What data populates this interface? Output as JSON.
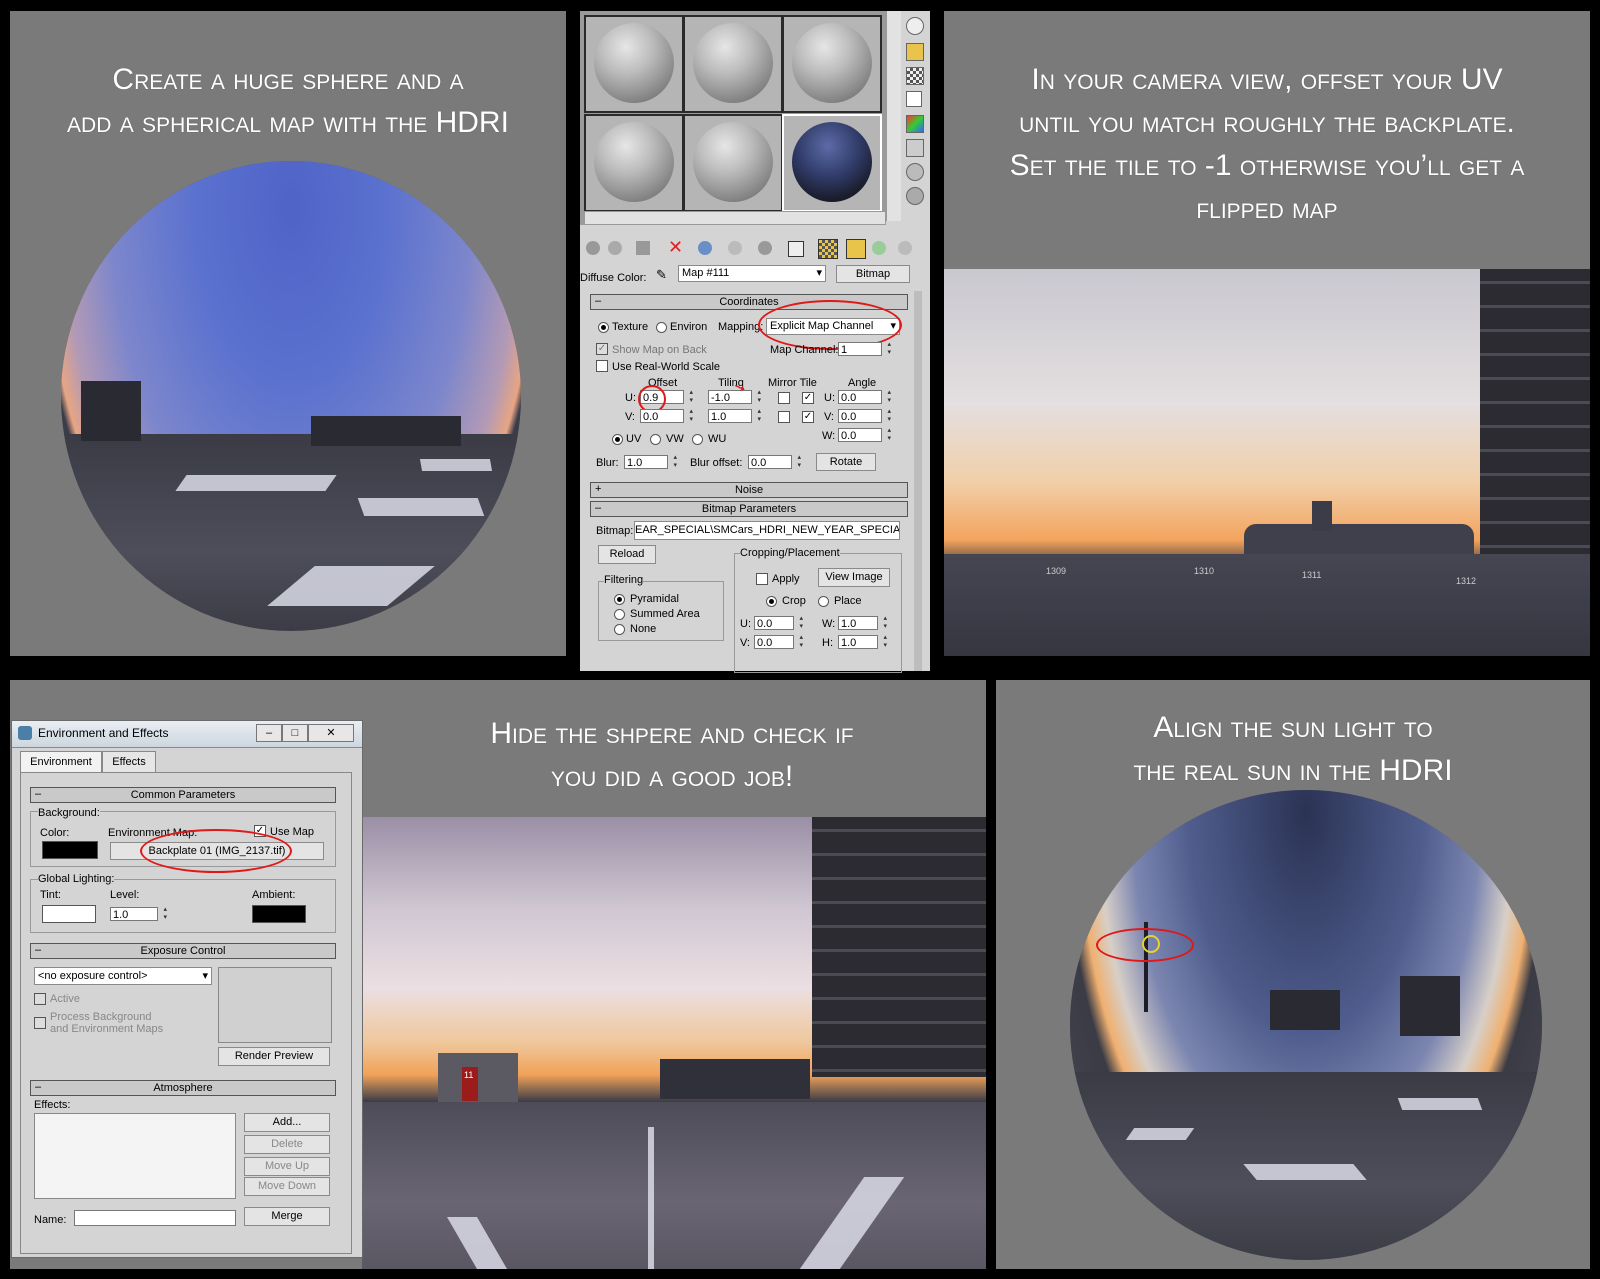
{
  "captions": {
    "top_left": [
      "Create a huge sphere and a",
      "add a spherical map with the HDRI"
    ],
    "top_right": [
      "In your camera view, offset your UV",
      "until you match roughly the backplate.",
      "Set the tile to -1 otherwise you’ll get a",
      "flipped map"
    ],
    "bottom_mid": [
      "Hide the shpere and check if",
      "you did a good job!"
    ],
    "bottom_right": [
      "Align the sun light to",
      "the real sun in the HDRI"
    ]
  },
  "colors": {
    "panel_bg": "#7a7a7a",
    "highlight_ring": "#e01818",
    "ui_bg": "#d4d4d4"
  },
  "material_editor": {
    "diffuse_label": "Diffuse Color:",
    "map_name": "Map #111",
    "map_type": "Bitmap",
    "coordinates": {
      "title": "Coordinates",
      "texture": "Texture",
      "environ": "Environ",
      "mapping_label": "Mapping:",
      "mapping_value": "Explicit Map Channel",
      "show_map_on_back": "Show Map on Back",
      "map_channel_label": "Map Channel:",
      "map_channel_value": "1",
      "use_real_world": "Use Real-World Scale",
      "offset": "Offset",
      "tiling": "Tiling",
      "mirror_tile": "Mirror Tile",
      "angle": "Angle",
      "u_label": "U:",
      "v_label": "V:",
      "w_label": "W:",
      "offset_u": "0.9",
      "offset_v": "0.0",
      "tiling_u": "-1.0",
      "tiling_v": "1.0",
      "angle_u": "0.0",
      "angle_v": "0.0",
      "angle_w": "0.0",
      "uv": "UV",
      "vw": "VW",
      "wu": "WU",
      "blur_label": "Blur:",
      "blur_value": "1.0",
      "blur_offset_label": "Blur offset:",
      "blur_offset_value": "0.0",
      "rotate": "Rotate"
    },
    "noise_title": "Noise",
    "bitmap_params": {
      "title": "Bitmap Parameters",
      "bitmap_label": "Bitmap:",
      "bitmap_path": "EAR_SPECIAL\\SMCars_HDRI_NEW_YEAR_SPECIAL.hdr",
      "reload": "Reload",
      "cropping": "Cropping/Placement",
      "apply": "Apply",
      "view_image": "View Image",
      "crop": "Crop",
      "place": "Place",
      "filtering": "Filtering",
      "pyramidal": "Pyramidal",
      "summed_area": "Summed Area",
      "none": "None",
      "u_label": "U:",
      "v_label": "V:",
      "w_label": "W:",
      "h_label": "H:",
      "u": "0.0",
      "v": "0.0",
      "w": "1.0",
      "h": "1.0"
    }
  },
  "env_dialog": {
    "title": "Environment and Effects",
    "tabs": [
      "Environment",
      "Effects"
    ],
    "common_params": "Common Parameters",
    "background": "Background:",
    "color": "Color:",
    "env_map": "Environment Map:",
    "use_map": "Use Map",
    "map_button": "Backplate 01 (IMG_2137.tif)",
    "global_lighting": "Global Lighting:",
    "tint": "Tint:",
    "level": "Level:",
    "level_value": "1.0",
    "ambient": "Ambient:",
    "exposure_control": "Exposure Control",
    "exposure_value": "<no exposure control>",
    "active": "Active",
    "process_bg_1": "Process Background",
    "process_bg_2": "and Environment Maps",
    "render_preview": "Render Preview",
    "atmosphere": "Atmosphere",
    "effects": "Effects:",
    "add": "Add...",
    "delete": "Delete",
    "move_up": "Move Up",
    "move_down": "Move Down",
    "name": "Name:",
    "merge": "Merge"
  },
  "photo_labels": {
    "l1": "1310",
    "l2": "1311",
    "l3": "1312",
    "l4": "1309",
    "door": "11"
  }
}
